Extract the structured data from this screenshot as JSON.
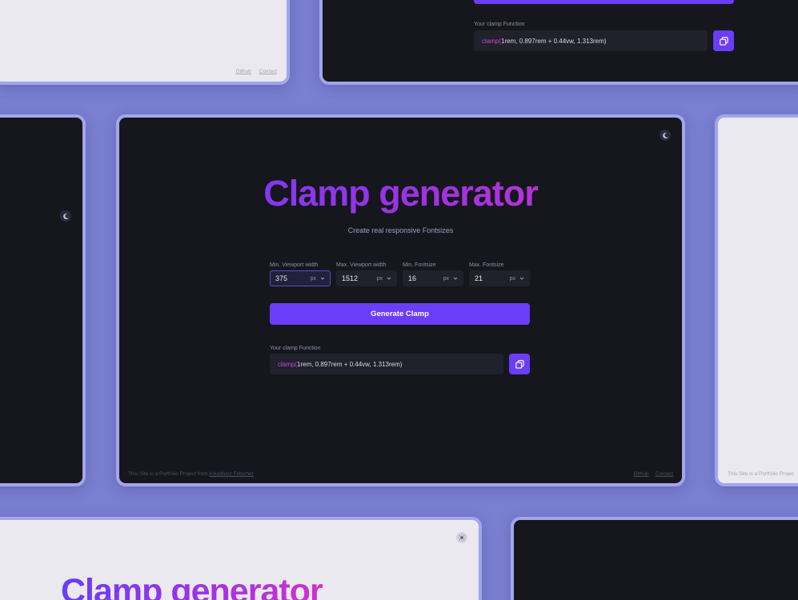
{
  "app": {
    "title": "Clamp generator",
    "subtitle": "Create real responsive Fontsizes"
  },
  "fields": [
    {
      "label": "Min. Viewport width",
      "value": "375",
      "unit": "px"
    },
    {
      "label": "Max. Viewport width",
      "value": "1512",
      "unit": "px"
    },
    {
      "label": "Min. Fontsize",
      "value": "16",
      "unit": "px"
    },
    {
      "label": "Max. Fontsize",
      "value": "21",
      "unit": "px"
    }
  ],
  "generate": {
    "label": "Generate Clamp"
  },
  "output": {
    "label": "Your clamp Function",
    "fn_name": "clamp(",
    "args": " 1rem, 0.897rem + 0.44vw, 1.313rem ",
    "close": ")"
  },
  "footer": {
    "left_text": "This Site is a Portfolio Project from ",
    "author": "Arkadiusz Fritscher",
    "links": [
      "Github",
      "Contact"
    ],
    "left_text_truncated": "This Site is a Portfolio Projec"
  },
  "icons": {
    "theme_dark": "moon-icon",
    "theme_light": "sun-icon",
    "copy": "copy-icon",
    "chevron": "chevron-down-icon"
  },
  "colors": {
    "background": "#7b7fd1",
    "accent": "#6a3df8",
    "gradient_end": "#cf33c9",
    "dark_surface": "#16161d",
    "light_surface": "#e9e9ef"
  }
}
